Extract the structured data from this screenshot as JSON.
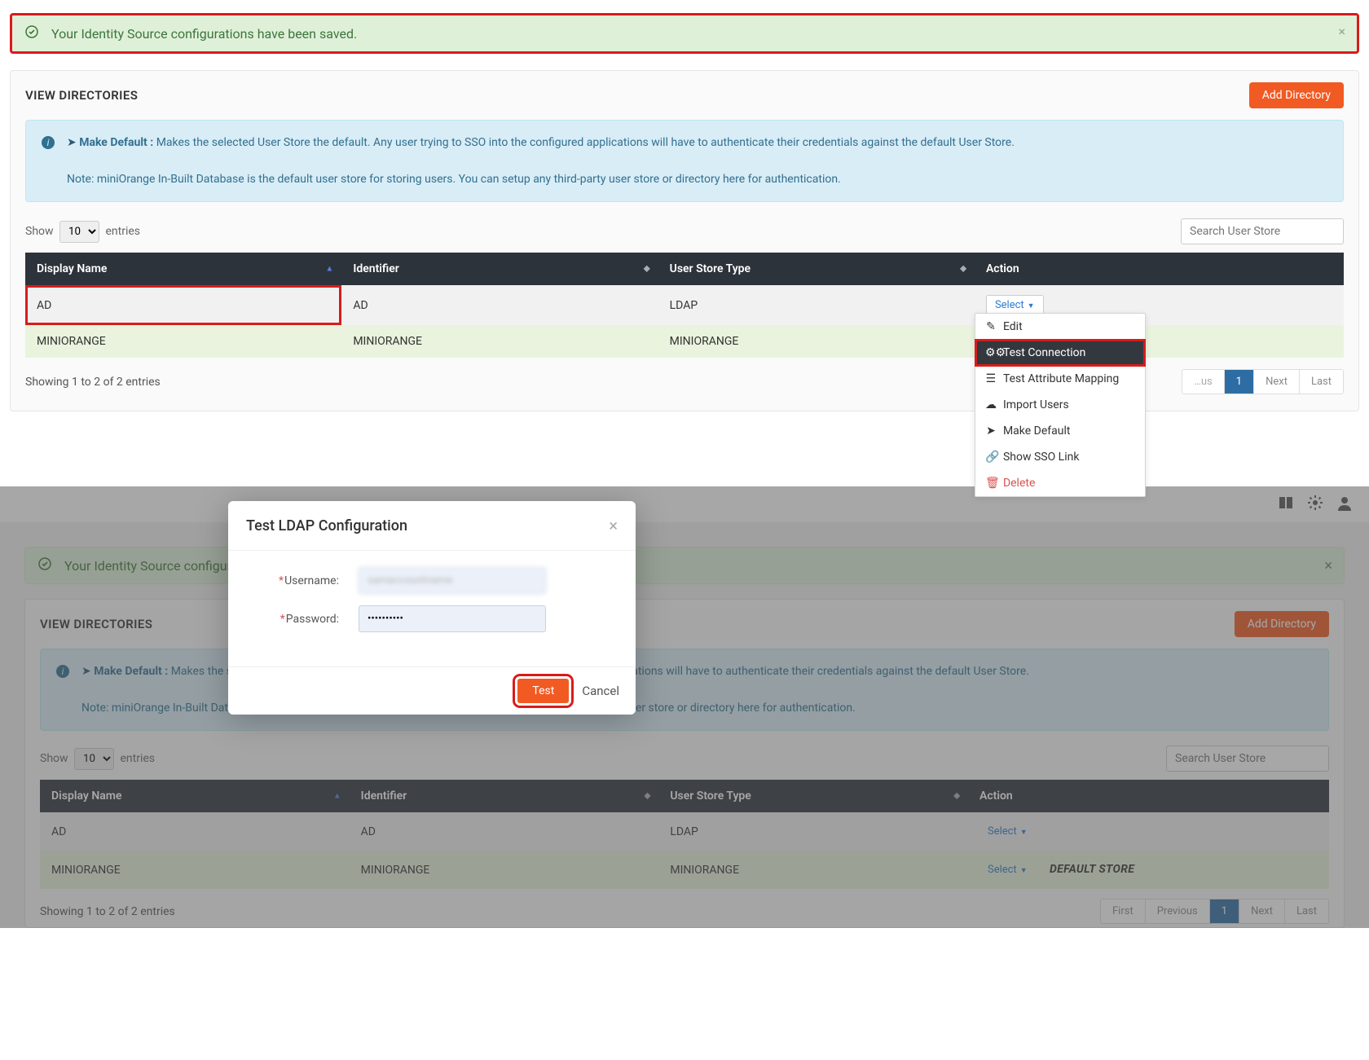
{
  "alert": {
    "message": "Your Identity Source configurations have been saved.",
    "close": "×"
  },
  "panel": {
    "title": "VIEW DIRECTORIES",
    "add_btn": "Add Directory"
  },
  "info": {
    "make_default_label": "Make Default :",
    "make_default_text": " Makes the selected User Store the default. Any user trying to SSO into the configured applications will have to authenticate their credentials against the default User Store.",
    "note": "Note: miniOrange In-Built Database is the default user store for storing users. You can setup any third-party user store or directory here for authentication."
  },
  "table": {
    "show_label": "Show",
    "entries_label": "entries",
    "page_size": "10",
    "search_placeholder": "Search User Store",
    "cols": {
      "display_name": "Display Name",
      "identifier": "Identifier",
      "user_store_type": "User Store Type",
      "action": "Action"
    },
    "rows": [
      {
        "display": "AD",
        "identifier": "AD",
        "type": "LDAP"
      },
      {
        "display": "MINIORANGE",
        "identifier": "MINIORANGE",
        "type": "MINIORANGE"
      }
    ],
    "select_label": "Select",
    "showing": "Showing 1 to 2 of 2 entries",
    "pager": {
      "first": "First",
      "prev_trunc": "…us",
      "page1": "1",
      "next": "Next",
      "last": "Last"
    },
    "pager2": {
      "first": "First",
      "prev": "Previous",
      "page1": "1",
      "next": "Next",
      "last": "Last"
    }
  },
  "dropdown": {
    "edit": "Edit",
    "test_connection": "Test Connection",
    "test_attribute": "Test Attribute Mapping",
    "import_users": "Import Users",
    "make_default": "Make Default",
    "show_sso": "Show SSO Link",
    "delete": "Delete"
  },
  "default_store_marker": "DEFAULT STORE",
  "modal": {
    "title": "Test LDAP Configuration",
    "close": "×",
    "username_label": "Username:",
    "password_label": "Password:",
    "username_value": "samaccountname",
    "password_value": "••••••••••",
    "test_btn": "Test",
    "cancel_btn": "Cancel"
  },
  "appbar": {
    "book": "📖",
    "gear": "⚙",
    "user": "👤"
  }
}
